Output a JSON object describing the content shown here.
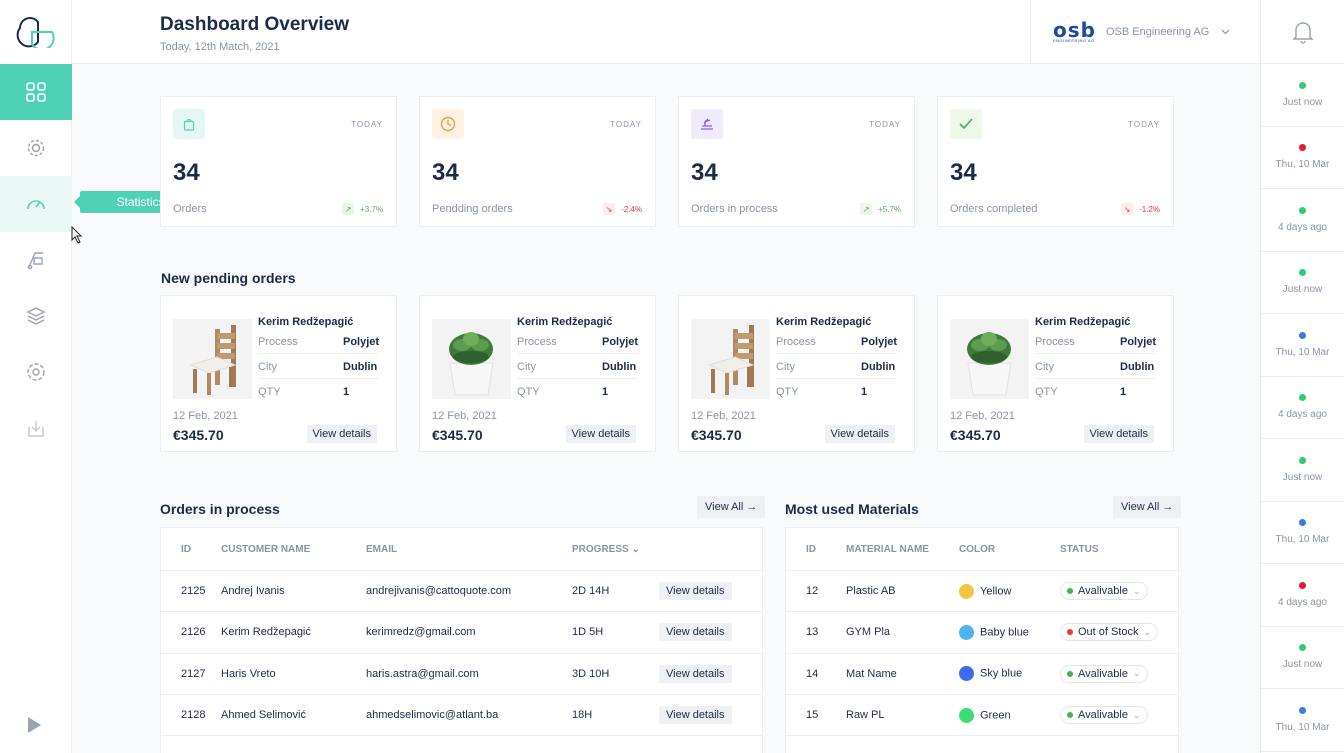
{
  "header": {
    "title": "Dashboard Overview",
    "date": "Today, 12th Match, 2021",
    "company_logo": "osb",
    "company_logo_sub": "ENGINEERING AG",
    "company_name": "OSB Engineering AG"
  },
  "sidebar": {
    "tooltip": "Statistics",
    "items": [
      "dashboard",
      "settings",
      "statistics",
      "shipping",
      "layers",
      "configuration",
      "download"
    ]
  },
  "stats": [
    {
      "today": "TODAY",
      "value": "34",
      "label": "Orders",
      "change": "+3.7%",
      "trend": "up",
      "icon_bg": "#e6f7f3",
      "icon_color": "#4fd1b5"
    },
    {
      "today": "TODAY",
      "value": "34",
      "label": "Pendding orders",
      "change": "-2.4%",
      "trend": "down",
      "icon_bg": "#fff1e3",
      "icon_color": "#f39c3c"
    },
    {
      "today": "TODAY",
      "value": "34",
      "label": "Orders in process",
      "change": "+5.7%",
      "trend": "up",
      "icon_bg": "#f0ebfb",
      "icon_color": "#8b5cf6"
    },
    {
      "today": "TODAY",
      "value": "34",
      "label": "Orders completed",
      "change": "-1.2%",
      "trend": "down",
      "icon_bg": "#eef8e6",
      "icon_color": "#4caf50"
    }
  ],
  "pending": {
    "title": "New pending orders",
    "orders": [
      {
        "name": "Kerim Redžepagić",
        "process_label": "Process",
        "process": "Polyjet",
        "city_label": "City",
        "city": "Dublin",
        "qty_label": "QTY",
        "qty": "1",
        "date": "12 Feb, 2021",
        "price": "€345.70",
        "cta": "View details",
        "image": "chair"
      },
      {
        "name": "Kerim Redžepagić",
        "process_label": "Process",
        "process": "Polyjet",
        "city_label": "City",
        "city": "Dublin",
        "qty_label": "QTY",
        "qty": "1",
        "date": "12 Feb, 2021",
        "price": "€345.70",
        "cta": "View details",
        "image": "succulent"
      },
      {
        "name": "Kerim Redžepagić",
        "process_label": "Process",
        "process": "Polyjet",
        "city_label": "City",
        "city": "Dublin",
        "qty_label": "QTY",
        "qty": "1",
        "date": "12 Feb, 2021",
        "price": "€345.70",
        "cta": "View details",
        "image": "chair"
      },
      {
        "name": "Kerim Redžepagić",
        "process_label": "Process",
        "process": "Polyjet",
        "city_label": "City",
        "city": "Dublin",
        "qty_label": "QTY",
        "qty": "1",
        "date": "12 Feb, 2021",
        "price": "€345.70",
        "cta": "View details",
        "image": "succulent"
      }
    ]
  },
  "process": {
    "title": "Orders in process",
    "view_all": "View All →",
    "columns": [
      "ID",
      "CUSTOMER NAME",
      "EMAIL",
      "PROGRESS"
    ],
    "rows": [
      {
        "id": "2125",
        "name": "Andrej Ivanis",
        "email": "andrejivanis@cattoquote.com",
        "progress": "2D 14H",
        "cta": "View details"
      },
      {
        "id": "2126",
        "name": "Kerim Redžepagić",
        "email": "kerimredz@gmail.com",
        "progress": "1D 5H",
        "cta": "View details"
      },
      {
        "id": "2127",
        "name": "Haris Vreto",
        "email": "haris.astra@gmail.com",
        "progress": "3D 10H",
        "cta": "View details"
      },
      {
        "id": "2128",
        "name": "Ahmed Selimović",
        "email": "ahmedselimovic@atlant.ba",
        "progress": "18H",
        "cta": "View details"
      }
    ]
  },
  "materials": {
    "title": "Most used Materials",
    "view_all": "View All →",
    "columns": [
      "ID",
      "MATERIAL NAME",
      "COLOR",
      "STATUS"
    ],
    "rows": [
      {
        "id": "12",
        "name": "Plastic AB",
        "color": "Yellow",
        "swatch": "#f5c542",
        "status": "Avalivable",
        "status_color": "#4caf50"
      },
      {
        "id": "13",
        "name": "GYM Pla",
        "color": "Baby blue",
        "swatch": "#4fb3f0",
        "status": "Out of Stock",
        "status_color": "#e53935"
      },
      {
        "id": "14",
        "name": "Mat Name",
        "color": "Sky blue",
        "swatch": "#3d6cf0",
        "status": "Avalivable",
        "status_color": "#4caf50"
      },
      {
        "id": "15",
        "name": "Raw PL",
        "color": "Green",
        "swatch": "#3ddc74",
        "status": "Avalivable",
        "status_color": "#4caf50"
      }
    ]
  },
  "notifications": [
    {
      "time": "Just now",
      "color": "#2ecc71"
    },
    {
      "time": "Thu, 10 Mar",
      "color": "#e01e2c"
    },
    {
      "time": "4 days ago",
      "color": "#2ecc71"
    },
    {
      "time": "Just now",
      "color": "#2ecc71"
    },
    {
      "time": "Thu, 10 Mar",
      "color": "#3a7be0"
    },
    {
      "time": "4 days ago",
      "color": "#2ecc71"
    },
    {
      "time": "Just now",
      "color": "#2ecc71"
    },
    {
      "time": "Thu, 10 Mar",
      "color": "#3a7be0"
    },
    {
      "time": "4 days ago",
      "color": "#e01e2c"
    },
    {
      "time": "Just now",
      "color": "#2ecc71"
    },
    {
      "time": "Thu, 10 Mar",
      "color": "#3a7be0"
    }
  ],
  "colors": {
    "accent": "#4fd1b5",
    "up": "#4caf50",
    "down": "#e53935"
  }
}
